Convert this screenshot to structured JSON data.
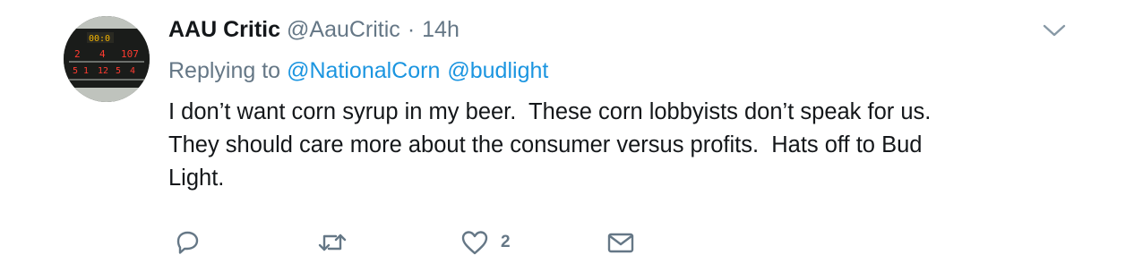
{
  "tweet": {
    "author_name": "AAU Critic",
    "author_handle": "@AauCritic",
    "separator": "·",
    "timestamp": "14h",
    "replying_to_label": "Replying to",
    "replying_to": [
      "@NationalCorn",
      "@budlight"
    ],
    "text": "I don’t want corn syrup in my beer.  These corn lobbyists don’t speak for us.\nThey should care more about the consumer versus profits.  Hats off to Bud\nLight.",
    "avatar": {
      "description_icon": "scoreboard-avatar",
      "scoreboard_digits": [
        "00:0",
        "2",
        "4",
        "107",
        "5",
        "1",
        "12",
        "5",
        "4"
      ]
    }
  },
  "actions": {
    "reply_icon": "reply-icon",
    "retweet_icon": "retweet-icon",
    "like_icon": "heart-icon",
    "like_count": "2",
    "dm_icon": "envelope-icon"
  },
  "menu": {
    "caret_icon": "chevron-down-icon"
  },
  "colors": {
    "text": "#14171a",
    "muted": "#657786",
    "link": "#1b95e0",
    "icon": "#657786"
  }
}
